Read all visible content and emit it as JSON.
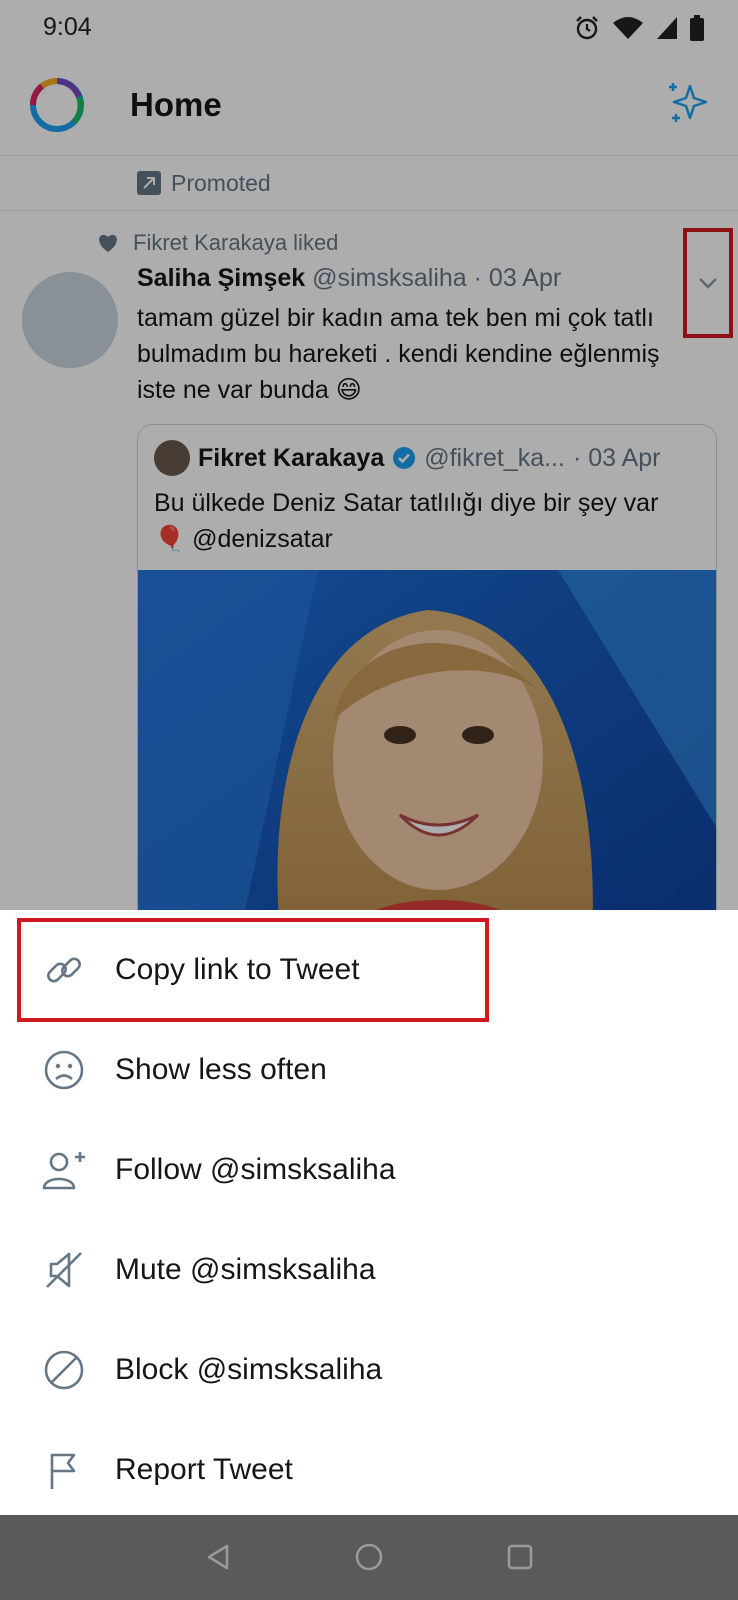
{
  "status_bar": {
    "time": "9:04",
    "icons": [
      "alarm-icon",
      "wifi-icon",
      "cell-signal-icon",
      "battery-icon"
    ]
  },
  "header": {
    "title": "Home",
    "logo": "app-logo-ring",
    "action_icon": "sparkle-icon"
  },
  "feed": {
    "promoted_label": "Promoted",
    "tweet": {
      "liked_by": "Fikret Karakaya liked",
      "author_name": "Saliha Şimşek",
      "author_handle": "@simsksaliha",
      "date": "· 03 Apr",
      "text": "tamam güzel bir kadın ama tek ben mi çok tatlı bulmadım bu hareketi . kendi kendine eğlenmiş  iste ne var bunda 😄",
      "quoted": {
        "author_name": "Fikret Karakaya",
        "author_handle": "@fikret_ka...",
        "date": "· 03 Apr",
        "text": "Bu ülkede Deniz Satar tatlılığı diye bir şey var 🎈 @denizsatar"
      }
    }
  },
  "menu": {
    "items": [
      {
        "label": "Copy link to Tweet",
        "icon": "link-icon"
      },
      {
        "label": "Show less often",
        "icon": "sad-face-icon"
      },
      {
        "label": "Follow @simsksaliha",
        "icon": "follow-user-icon"
      },
      {
        "label": "Mute @simsksaliha",
        "icon": "mute-icon"
      },
      {
        "label": "Block @simsksaliha",
        "icon": "block-icon"
      },
      {
        "label": "Report Tweet",
        "icon": "flag-icon"
      }
    ]
  },
  "colors": {
    "accent": "#1da1f2",
    "highlight": "#d0191f",
    "secondary_text": "#657786",
    "icon": "#657786"
  }
}
